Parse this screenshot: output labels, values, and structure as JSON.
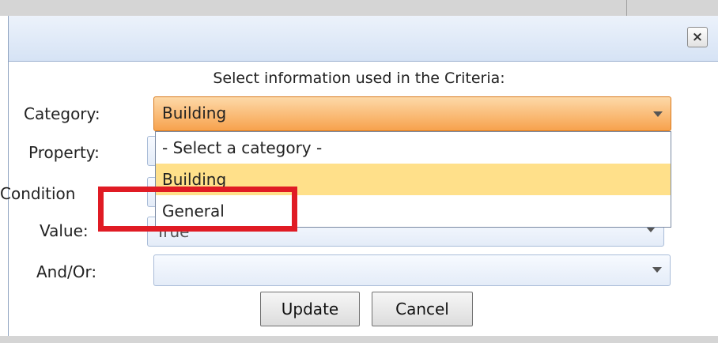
{
  "dialog": {
    "close_label": "×",
    "heading": "Select information used in the Criteria:"
  },
  "form": {
    "category_label": "Category:",
    "category_value": "Building",
    "property_label": "Property:",
    "condition_label": "Condition",
    "value_label": "Value:",
    "value_partial": "True",
    "andor_label": "And/Or:"
  },
  "dropdown": {
    "options": [
      "- Select a category -",
      "Building",
      "General"
    ],
    "selected_index": 1
  },
  "buttons": {
    "update": "Update",
    "cancel": "Cancel"
  },
  "colors": {
    "highlight": "#e01b24",
    "active_field": "#f7a24d",
    "selected_option": "#ffe08a"
  }
}
